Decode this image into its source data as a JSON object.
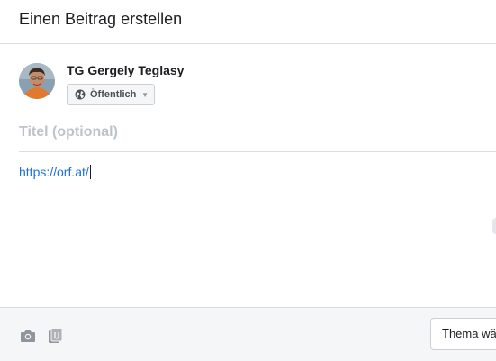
{
  "header": {
    "title": "Einen Beitrag erstellen"
  },
  "author": {
    "name": "TG Gergely Teglasy"
  },
  "audience": {
    "label": "Öffentlich",
    "icon": "globe-icon"
  },
  "post": {
    "title_placeholder": "Titel (optional)",
    "body_text": "https://orf.at/"
  },
  "footer": {
    "tools": [
      {
        "icon": "camera-icon"
      },
      {
        "icon": "attachment-icon"
      }
    ],
    "topic_button": "Thema wä"
  },
  "colors": {
    "link": "#216fdb",
    "placeholder": "#bec3c9",
    "footer_bg": "#f5f6f7",
    "divider": "#dadde1"
  }
}
